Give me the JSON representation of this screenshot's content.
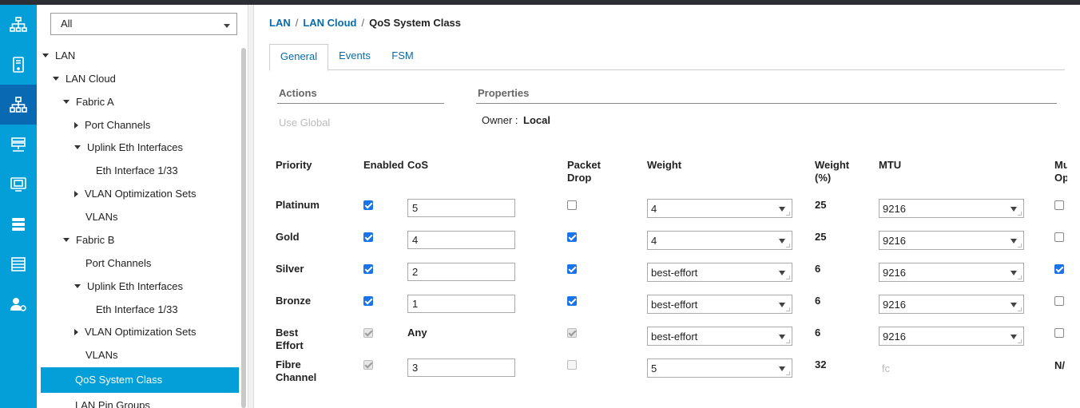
{
  "rail": {
    "items": [
      {
        "icon": "equipment-icon"
      },
      {
        "icon": "servers-icon"
      },
      {
        "icon": "lan-icon"
      },
      {
        "icon": "san-icon"
      },
      {
        "icon": "vm-icon"
      },
      {
        "icon": "storage-icon"
      },
      {
        "icon": "chassis-icon"
      },
      {
        "icon": "admin-icon"
      }
    ]
  },
  "nav": {
    "filter_value": "All",
    "tree": [
      {
        "label": "LAN",
        "expander": "down"
      },
      {
        "label": "LAN Cloud",
        "expander": "down"
      },
      {
        "label": "Fabric A",
        "expander": "down"
      },
      {
        "label": "Port Channels",
        "expander": "right"
      },
      {
        "label": "Uplink Eth Interfaces",
        "expander": "down"
      },
      {
        "label": "Eth Interface 1/33",
        "expander": "none"
      },
      {
        "label": "VLAN Optimization Sets",
        "expander": "right"
      },
      {
        "label": "VLANs",
        "expander": "none"
      },
      {
        "label": "Fabric B",
        "expander": "down"
      },
      {
        "label": "Port Channels",
        "expander": "none"
      },
      {
        "label": "Uplink Eth Interfaces",
        "expander": "down"
      },
      {
        "label": "Eth Interface 1/33",
        "expander": "none"
      },
      {
        "label": "VLAN Optimization Sets",
        "expander": "right"
      },
      {
        "label": "VLANs",
        "expander": "none"
      },
      {
        "label": "QoS System Class",
        "expander": "none"
      },
      {
        "label": "LAN Pin Groups",
        "expander": "none"
      }
    ],
    "selected_label": "QoS System Class"
  },
  "breadcrumb": {
    "items": [
      "LAN",
      "LAN Cloud"
    ],
    "separator": "/",
    "current": "QoS System Class"
  },
  "tabs": [
    {
      "label": "General",
      "active": true
    },
    {
      "label": "Events",
      "active": false
    },
    {
      "label": "FSM",
      "active": false
    }
  ],
  "actions": {
    "title": "Actions",
    "use_global": "Use Global"
  },
  "properties": {
    "title": "Properties",
    "owner_label": "Owner :",
    "owner_value": "Local"
  },
  "table": {
    "headers": {
      "priority": "Priority",
      "enabled": "Enabled",
      "cos": "CoS",
      "packet_drop": "Packet Drop",
      "weight": "Weight",
      "weight_pct": "Weight (%)",
      "mtu": "MTU",
      "multicast": "Mu Op"
    },
    "rows": [
      {
        "priority": "Platinum",
        "enabled": true,
        "enabled_disabled": false,
        "cos": "5",
        "cos_type": "input",
        "packet_drop": false,
        "drop_disabled": false,
        "weight": "4",
        "weight_pct": "25",
        "mtu": "9216",
        "mtu_type": "select",
        "multicast": false,
        "multicast_type": "checkbox"
      },
      {
        "priority": "Gold",
        "enabled": true,
        "enabled_disabled": false,
        "cos": "4",
        "cos_type": "input",
        "packet_drop": true,
        "drop_disabled": false,
        "weight": "4",
        "weight_pct": "25",
        "mtu": "9216",
        "mtu_type": "select",
        "multicast": false,
        "multicast_type": "checkbox"
      },
      {
        "priority": "Silver",
        "enabled": true,
        "enabled_disabled": false,
        "cos": "2",
        "cos_type": "input",
        "packet_drop": true,
        "drop_disabled": false,
        "weight": "best-effort",
        "weight_pct": "6",
        "mtu": "9216",
        "mtu_type": "select",
        "multicast": true,
        "multicast_type": "checkbox"
      },
      {
        "priority": "Bronze",
        "enabled": true,
        "enabled_disabled": false,
        "cos": "1",
        "cos_type": "input",
        "packet_drop": true,
        "drop_disabled": false,
        "weight": "best-effort",
        "weight_pct": "6",
        "mtu": "9216",
        "mtu_type": "select",
        "multicast": false,
        "multicast_type": "checkbox"
      },
      {
        "priority": "Best Effort",
        "enabled": true,
        "enabled_disabled": true,
        "cos": "Any",
        "cos_type": "text",
        "packet_drop": true,
        "drop_disabled": true,
        "weight": "best-effort",
        "weight_pct": "6",
        "mtu": "9216",
        "mtu_type": "select",
        "multicast": false,
        "multicast_type": "checkbox"
      },
      {
        "priority": "Fibre Channel",
        "enabled": true,
        "enabled_disabled": true,
        "cos": "3",
        "cos_type": "input",
        "packet_drop": false,
        "drop_disabled": true,
        "weight": "5",
        "weight_pct": "32",
        "mtu": "fc",
        "mtu_type": "text",
        "multicast": "N/",
        "multicast_type": "text"
      }
    ]
  },
  "colors": {
    "rail": "#049fd9",
    "rail_active": "#0a69b3",
    "link": "#0b6aa8",
    "selected_row": "#049fd9",
    "checkbox": "#1a73e8"
  }
}
